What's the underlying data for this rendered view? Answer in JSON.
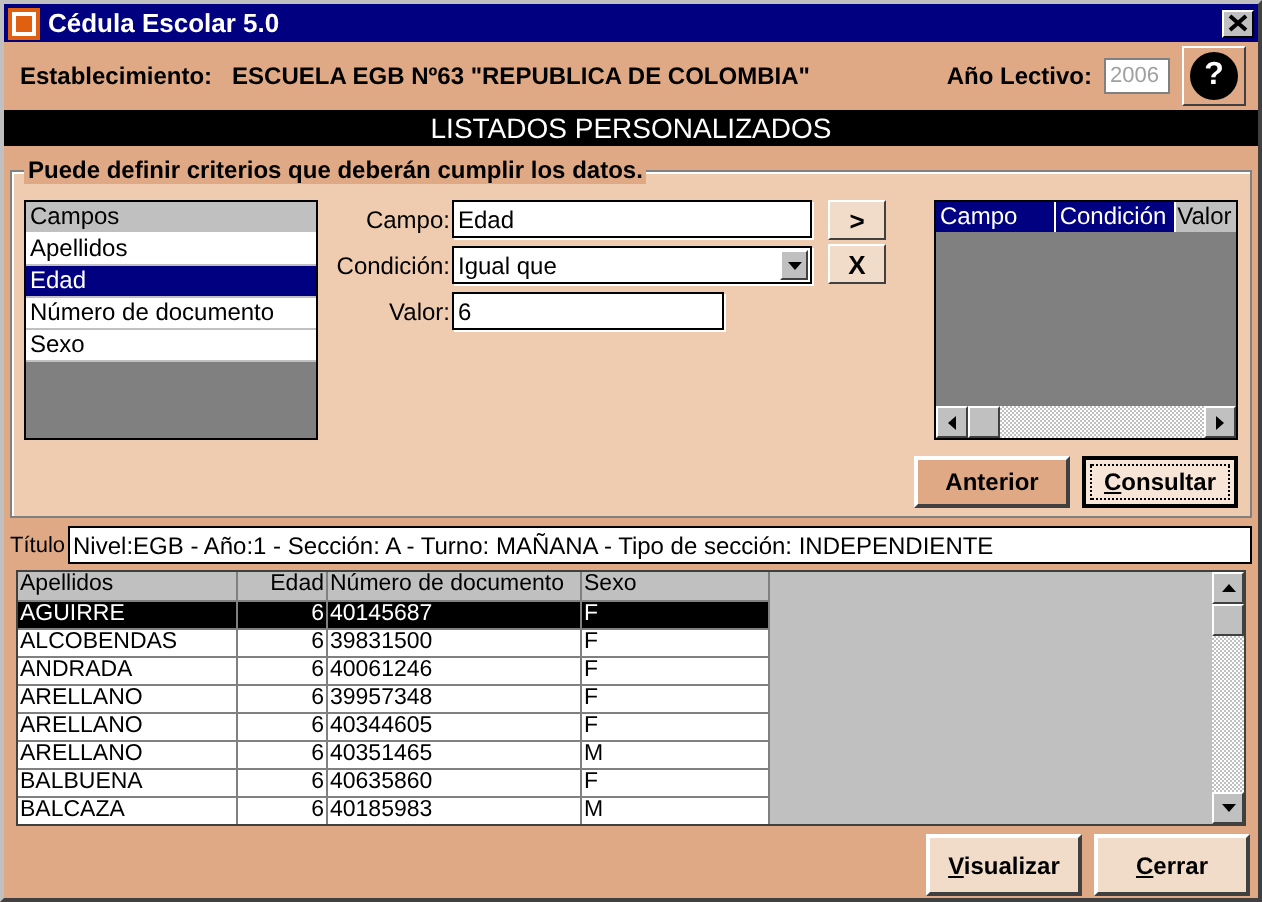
{
  "window": {
    "title": "Cédula Escolar 5.0"
  },
  "header": {
    "label": "Establecimiento:",
    "school": "ESCUELA EGB Nº63 \"REPUBLICA DE COLOMBIA\"",
    "year_label": "Año Lectivo:",
    "year": "2006",
    "help": "?"
  },
  "banner": "LISTADOS PERSONALIZADOS",
  "criteria": {
    "legend": "Puede definir criterios que deberán cumplir los datos.",
    "fields_header": "Campos",
    "fields": [
      {
        "label": "Apellidos",
        "selected": false
      },
      {
        "label": "Edad",
        "selected": true
      },
      {
        "label": "Número de documento",
        "selected": false
      },
      {
        "label": "Sexo",
        "selected": false
      }
    ],
    "campo_label": "Campo:",
    "campo": "Edad",
    "condicion_label": "Condición:",
    "condicion": "Igual que",
    "valor_label": "Valor:",
    "valor": "6",
    "add": ">",
    "remove": "X",
    "criteria_columns": [
      "Campo",
      "Condición",
      "Valor"
    ],
    "buttons": [
      {
        "label": "Anterior",
        "focused": false
      },
      {
        "label": "Consultar",
        "focused": true
      }
    ]
  },
  "title_label": "Título",
  "title_value": "Nivel:EGB - Año:1 - Sección: A - Turno: MAÑANA - Tipo de sección: INDEPENDIENTE",
  "table": {
    "columns": [
      "Apellidos",
      "Edad",
      "Número de documento",
      "Sexo"
    ],
    "rows": [
      {
        "cells": [
          "AGUIRRE",
          "6",
          "40145687",
          "F"
        ],
        "selected": true
      },
      {
        "cells": [
          "ALCOBENDAS",
          "6",
          "39831500",
          "F"
        ],
        "selected": false
      },
      {
        "cells": [
          "ANDRADA",
          "6",
          "40061246",
          "F"
        ],
        "selected": false
      },
      {
        "cells": [
          "ARELLANO",
          "6",
          "39957348",
          "F"
        ],
        "selected": false
      },
      {
        "cells": [
          "ARELLANO",
          "6",
          "40344605",
          "F"
        ],
        "selected": false
      },
      {
        "cells": [
          "ARELLANO",
          "6",
          "40351465",
          "M"
        ],
        "selected": false
      },
      {
        "cells": [
          "BALBUENA",
          "6",
          "40635860",
          "F"
        ],
        "selected": false
      },
      {
        "cells": [
          "BALCAZA",
          "6",
          "40185983",
          "M"
        ],
        "selected": false
      }
    ]
  },
  "footer_buttons": [
    "Visualizar",
    "Cerrar"
  ]
}
